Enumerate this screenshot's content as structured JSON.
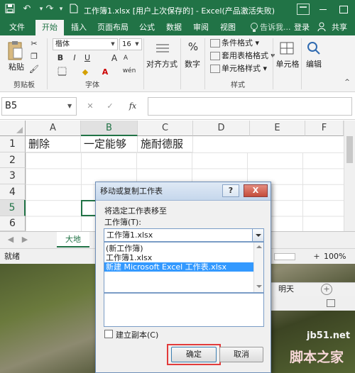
{
  "window": {
    "title": "工作簿1.xlsx [用户上次保存的] - Excel(产品激活失败)",
    "brand_color": "#217346"
  },
  "ribbon_tabs": [
    "文件",
    "开始",
    "插入",
    "页面布局",
    "公式",
    "数据",
    "审阅",
    "视图"
  ],
  "active_tab": "开始",
  "tell_me": "告诉我...",
  "sign_in": "登录",
  "share": "共享",
  "ribbon": {
    "clipboard": {
      "paste": "粘贴",
      "group": "剪贴板"
    },
    "font": {
      "name": "楷体",
      "size": "16",
      "group": "字体",
      "bold": "B",
      "italic": "I",
      "underline": "U",
      "grow": "A",
      "shrink": "A"
    },
    "alignment": {
      "label": "对齐方式"
    },
    "number": {
      "label": "数字",
      "icon": "%"
    },
    "styles": {
      "conditional": "条件格式",
      "table": "套用表格格式",
      "cell": "单元格样式",
      "group": "样式"
    },
    "cells": {
      "label": "单元格"
    },
    "editing": {
      "label": "编辑"
    }
  },
  "formula_bar": {
    "name_box": "B5",
    "fx": "fx",
    "cancel": "✕",
    "enter": "✓",
    "value": ""
  },
  "grid": {
    "columns": [
      "A",
      "B",
      "C",
      "D",
      "E",
      "F"
    ],
    "selected_column": "B",
    "rows": [
      "1",
      "2",
      "3",
      "4",
      "5",
      "6"
    ],
    "selected_row": "5",
    "cells": {
      "A1": "删除",
      "B1": "一定能够",
      "C1": "施耐德服"
    }
  },
  "sheet_tab": "大地",
  "status": {
    "text": "就绪",
    "zoom": "100%"
  },
  "background_tab": "明天",
  "dialog": {
    "title": "移动或复制工作表",
    "help": "?",
    "close": "X",
    "move_to_label": "将选定工作表移至",
    "workbook_label": "工作簿(T):",
    "workbook_value": "工作簿1.xlsx",
    "options": [
      "(新工作簿)",
      "工作簿1.xlsx",
      "新建 Microsoft Excel 工作表.xlsx"
    ],
    "highlighted_option": "新建 Microsoft Excel 工作表.xlsx",
    "create_copy_label": "建立副本(C)",
    "create_copy_checked": false,
    "ok": "确定",
    "cancel": "取消"
  },
  "watermark": {
    "line1": "jb51.net",
    "line2": "脚本之家"
  }
}
